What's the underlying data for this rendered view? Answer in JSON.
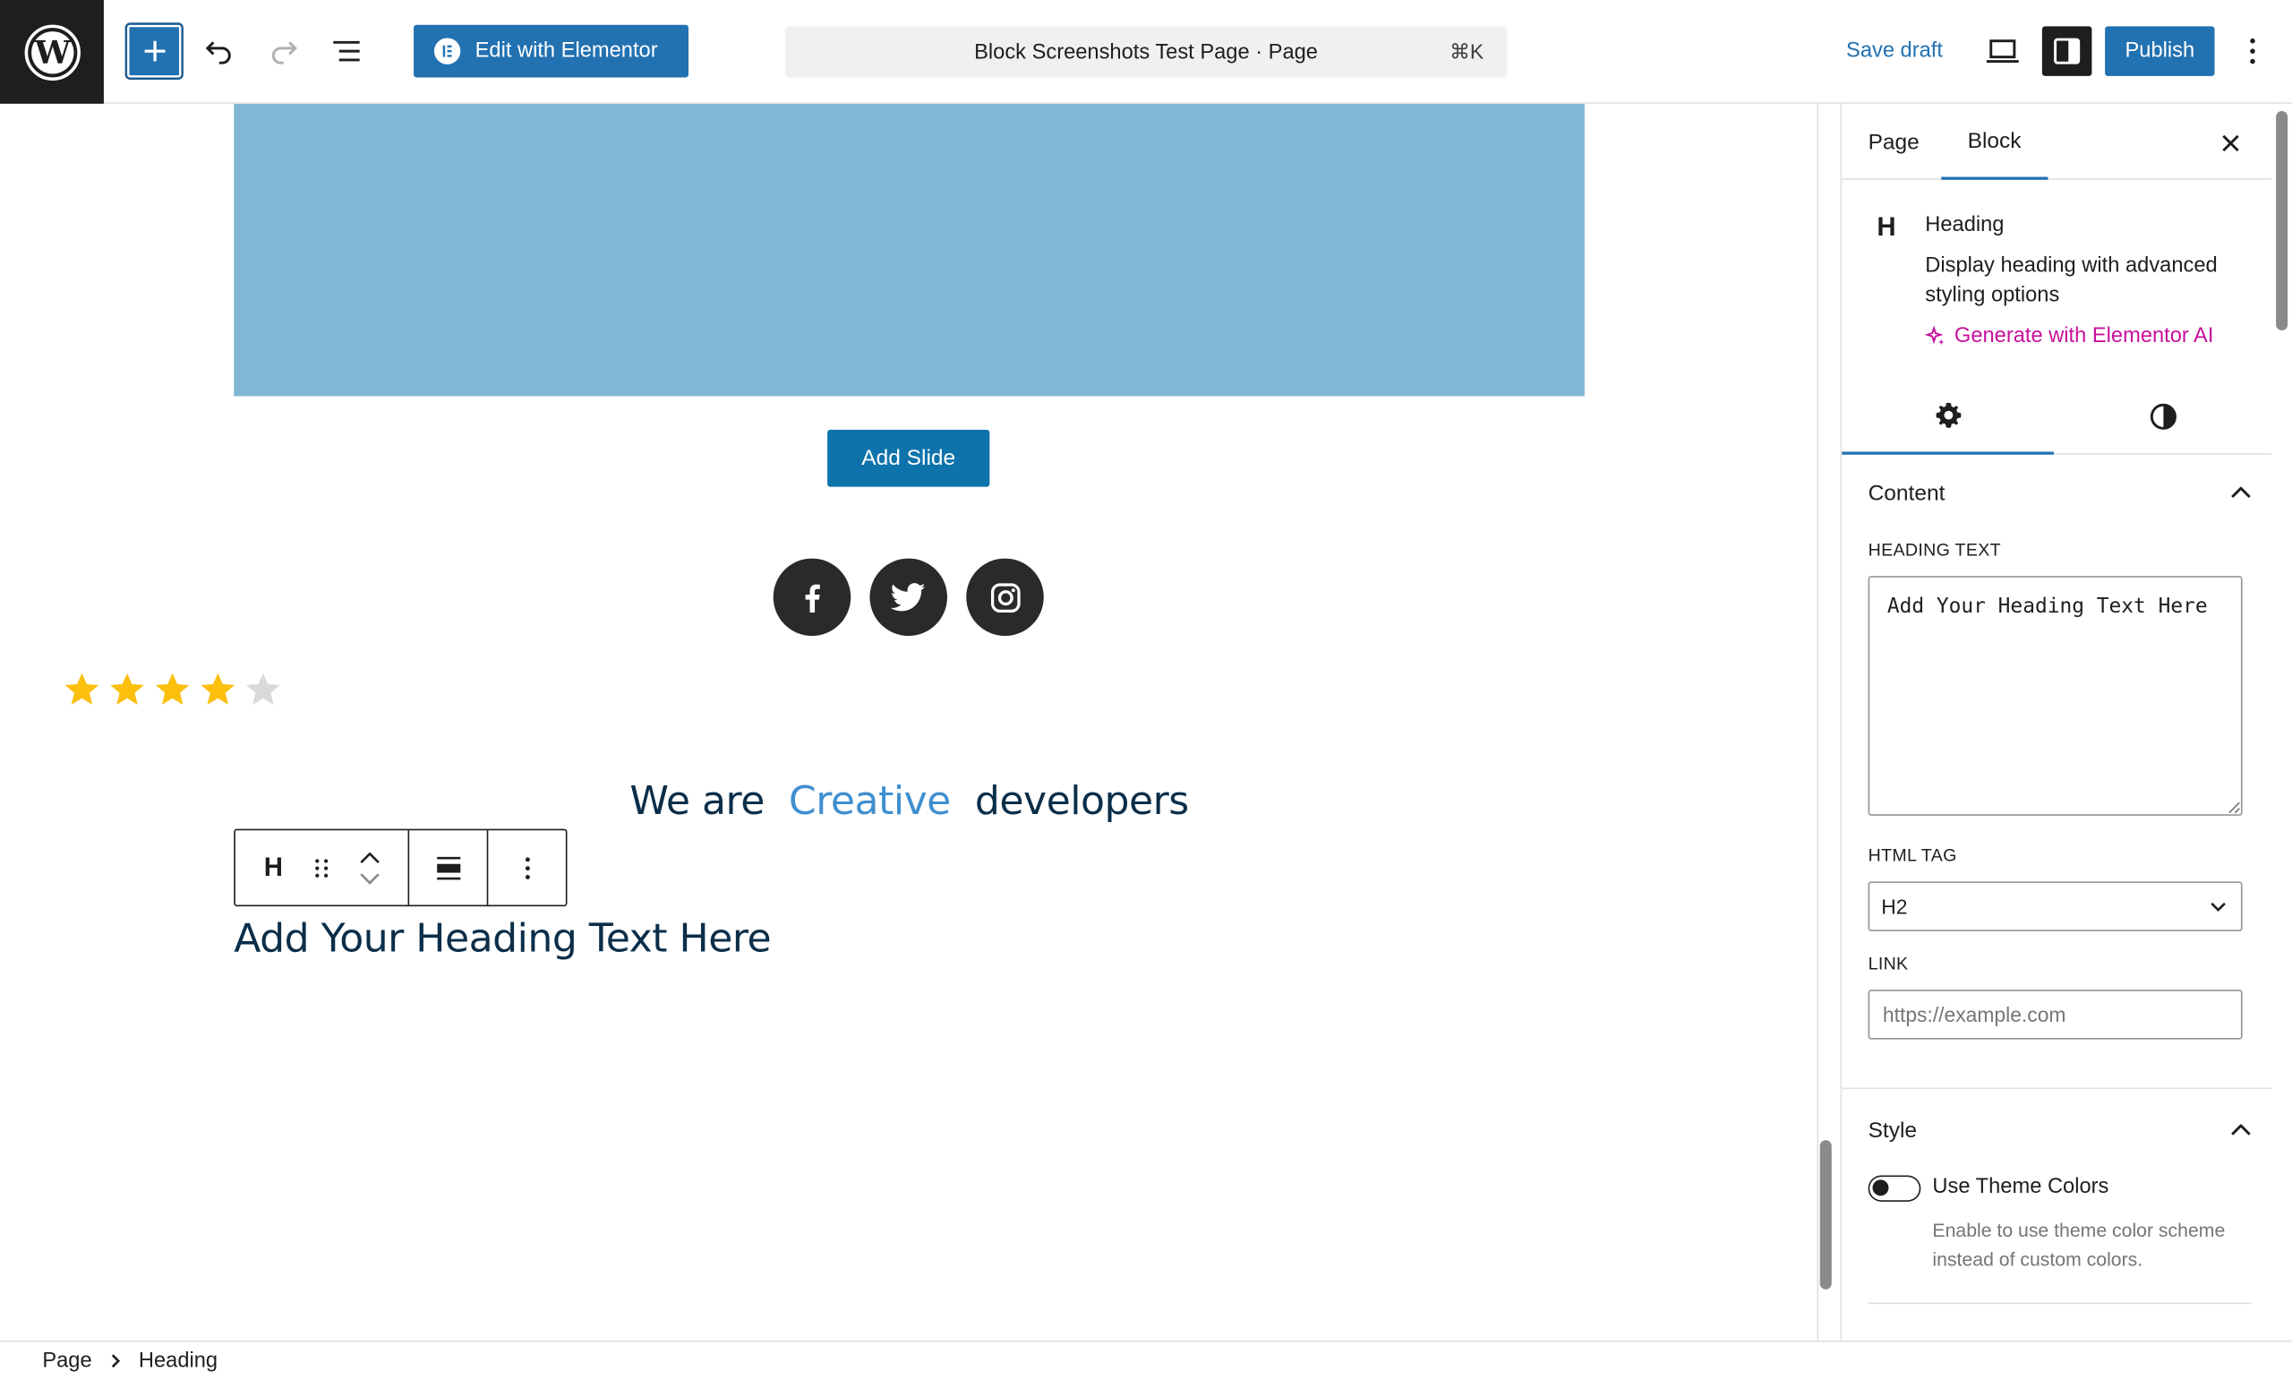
{
  "header": {
    "edit_elementor_label": "Edit with Elementor",
    "command_bar_title": "Block Screenshots Test Page · Page",
    "command_shortcut": "⌘K",
    "save_draft_label": "Save draft",
    "publish_label": "Publish"
  },
  "canvas": {
    "add_slide_label": "Add Slide",
    "social_icons": [
      "facebook-icon",
      "twitter-icon",
      "instagram-icon"
    ],
    "rating": {
      "value": 4,
      "max": 5
    },
    "creative_heading": {
      "before": "We are",
      "highlight": "Creative",
      "after": "developers"
    },
    "heading_text": "Add Your Heading Text Here",
    "colors": {
      "slide_bg": "#7fb7d5",
      "heading": "#0b2e49",
      "highlight": "#3f8fd0",
      "star": "#fbbf0e"
    }
  },
  "sidebar": {
    "tabs": [
      "Page",
      "Block"
    ],
    "active_tab": "Block",
    "block_icon_letter": "H",
    "block_title": "Heading",
    "block_description": "Display heading with advanced styling options",
    "generate_ai_label": "Generate with Elementor AI",
    "content_panel": {
      "title": "Content",
      "heading_text_label": "Heading Text",
      "heading_text_value": "Add Your Heading Text Here",
      "html_tag_label": "HTML Tag",
      "html_tag_value": "H2",
      "link_label": "Link",
      "link_placeholder": "https://example.com"
    },
    "style_panel": {
      "title": "Style",
      "toggle_label": "Use Theme Colors",
      "toggle_help": "Enable to use theme color scheme instead of custom colors.",
      "toggle_on": false
    }
  },
  "footer": {
    "breadcrumb": [
      "Page",
      "Heading"
    ]
  },
  "accent_colors": {
    "primary": "#2271b1",
    "ai": "#c7119c",
    "dark": "#1e1e1e"
  }
}
